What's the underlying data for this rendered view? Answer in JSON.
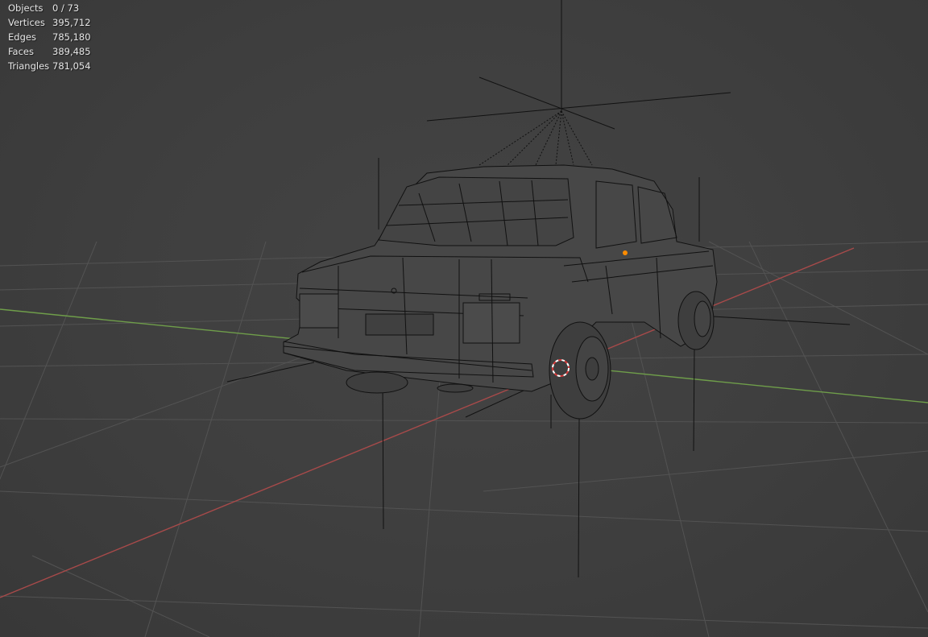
{
  "viewport": {
    "background_color": "#3d3d3d",
    "x_axis_color": "#a84a4a",
    "y_axis_color": "#6f9e4a",
    "grid_color": "#535353",
    "wire_color": "#111111",
    "selection_color": "#ff8c00"
  },
  "stats": [
    {
      "label": "Objects",
      "value": "0 / 73"
    },
    {
      "label": "Vertices",
      "value": "395,712"
    },
    {
      "label": "Edges",
      "value": "785,180"
    },
    {
      "label": "Faces",
      "value": "389,485"
    },
    {
      "label": "Triangles",
      "value": "781,054"
    }
  ],
  "icons": {
    "light_object": "light-object-icon",
    "origin_marker": "object-origin-icon",
    "cursor_3d": "3d-cursor-icon"
  }
}
